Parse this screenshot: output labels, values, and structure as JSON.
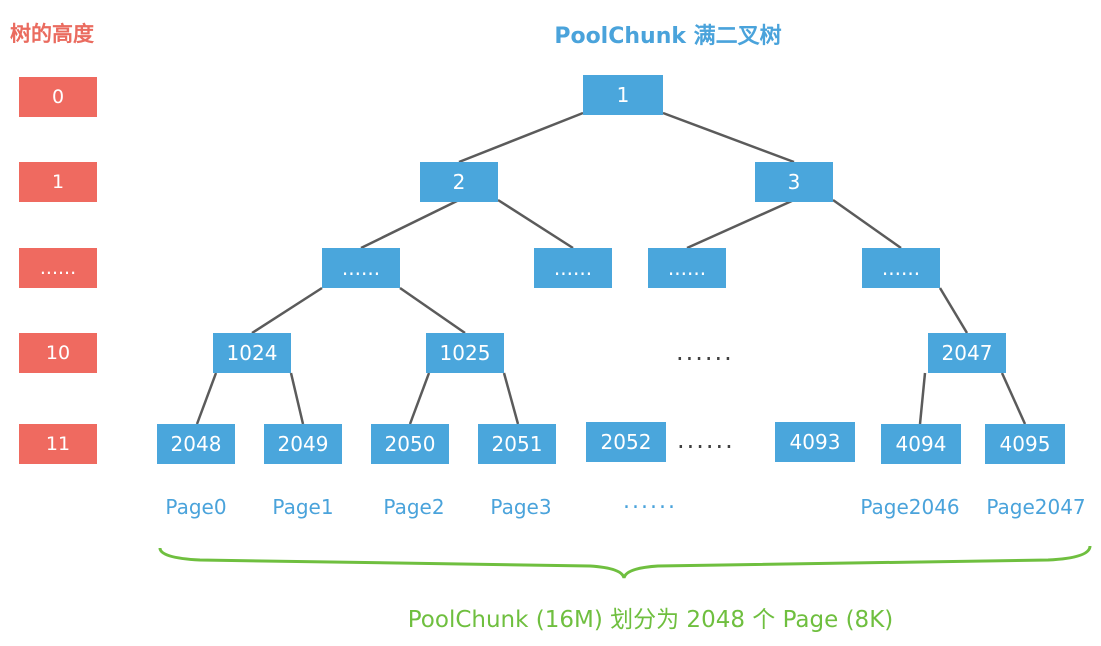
{
  "header": {
    "height_title": "树的高度",
    "tree_title": "PoolChunk 满二叉树"
  },
  "levels": [
    "0",
    "1",
    "......",
    "10",
    "11"
  ],
  "nodes": {
    "n1": "1",
    "n2": "2",
    "n3": "3",
    "d1": "......",
    "d2": "......",
    "d3": "......",
    "d4": "......",
    "n1024": "1024",
    "n1025": "1025",
    "n2047": "2047",
    "mid_dots": "......",
    "n2048": "2048",
    "n2049": "2049",
    "n2050": "2050",
    "n2051": "2051",
    "n2052": "2052",
    "leaf_dots": "......",
    "n4093": "4093",
    "n4094": "4094",
    "n4095": "4095"
  },
  "pages": {
    "p0": "Page0",
    "p1": "Page1",
    "p2": "Page2",
    "p3": "Page3",
    "dots": "......",
    "p2046": "Page2046",
    "p2047": "Page2047"
  },
  "footer": "PoolChunk (16M) 划分为 2048 个 Page (8K)"
}
